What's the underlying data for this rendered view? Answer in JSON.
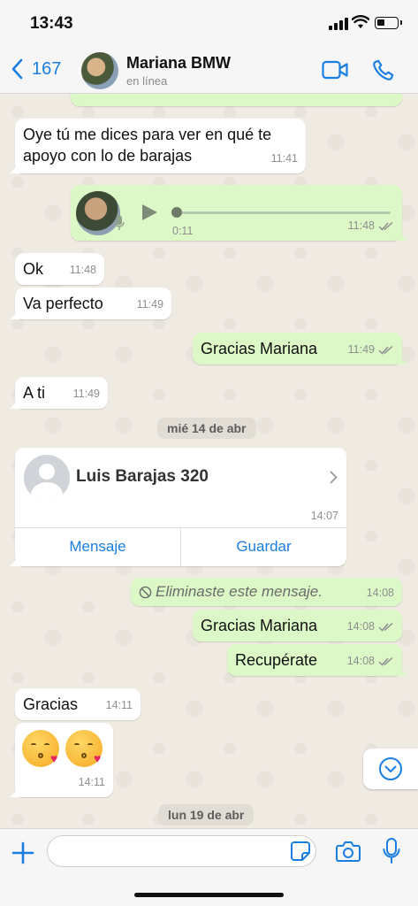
{
  "status_bar": {
    "time": "13:43"
  },
  "header": {
    "back_count": "167",
    "contact_name": "Mariana BMW",
    "contact_status": "en línea"
  },
  "messages": [
    {
      "text": "Oye tú me dices para ver en qué te",
      "text2": "apoyo con lo de barajas",
      "time": "11:41"
    },
    {
      "type": "voice",
      "duration": "0:11",
      "time": "11:48"
    },
    {
      "text": "Ok",
      "time": "11:48"
    },
    {
      "text": "Va perfecto",
      "time": "11:49"
    },
    {
      "text": "Gracias Mariana",
      "time": "11:49"
    },
    {
      "text": "A ti",
      "time": "11:49"
    },
    {
      "type": "contact",
      "name": "Luis Barajas  320",
      "time": "14:07",
      "action_message": "Mensaje",
      "action_save": "Guardar"
    },
    {
      "text": "Eliminaste este mensaje.",
      "time": "14:08"
    },
    {
      "text": "Gracias Mariana",
      "time": "14:08"
    },
    {
      "text": "Recupérate",
      "time": "14:08"
    },
    {
      "text": "Gracias",
      "time": "14:11"
    },
    {
      "type": "emoji",
      "emoji_names": [
        "face-blowing-a-kiss",
        "face-blowing-a-kiss"
      ],
      "time": "14:11"
    }
  ],
  "date_chips": [
    "mié 14 de abr",
    "lun 19 de abr"
  ],
  "input": {
    "value": "",
    "placeholder": ""
  },
  "colors": {
    "accent": "#1a7ee0",
    "outgoing_bubble": "#dcf8c6",
    "incoming_bubble": "#ffffff",
    "chat_bg": "#efeae2",
    "read_ticks": "#8e8e8e"
  }
}
